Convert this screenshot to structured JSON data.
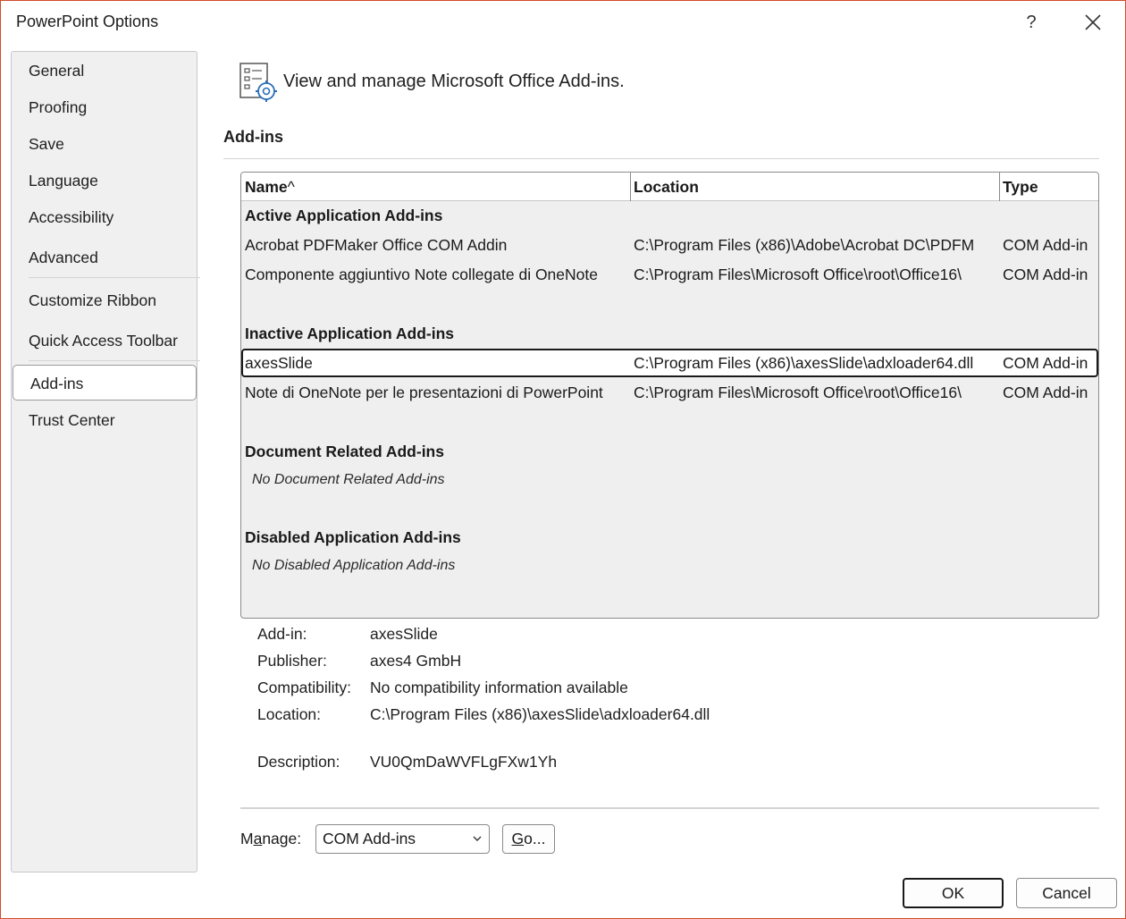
{
  "window": {
    "title": "PowerPoint Options",
    "help_label": "?",
    "close_icon": "close-icon",
    "border_color": "#d24b2a"
  },
  "sidebar": {
    "items": [
      {
        "label": "General"
      },
      {
        "label": "Proofing"
      },
      {
        "label": "Save"
      },
      {
        "label": "Language"
      },
      {
        "label": "Accessibility"
      },
      {
        "label": "Advanced"
      },
      {
        "label": "Customize Ribbon"
      },
      {
        "label": "Quick Access Toolbar"
      },
      {
        "label": "Add-ins",
        "selected": true
      },
      {
        "label": "Trust Center"
      }
    ]
  },
  "header": {
    "icon": "addins-settings-icon",
    "text": "View and manage Microsoft Office Add-ins."
  },
  "section": {
    "title": "Add-ins"
  },
  "table": {
    "columns": [
      {
        "label": "Name",
        "sort_indicator": "^"
      },
      {
        "label": "Location"
      },
      {
        "label": "Type"
      }
    ],
    "groups": [
      {
        "title": "Active Application Add-ins",
        "rows": [
          {
            "name": "Acrobat PDFMaker Office COM Addin",
            "location": "C:\\Program Files (x86)\\Adobe\\Acrobat DC\\PDFM",
            "type": "COM Add-in"
          },
          {
            "name": "Componente aggiuntivo Note collegate di OneNote",
            "location": "C:\\Program Files\\Microsoft Office\\root\\Office16\\",
            "type": "COM Add-in"
          }
        ]
      },
      {
        "title": "Inactive Application Add-ins",
        "rows": [
          {
            "name": "axesSlide",
            "location": "C:\\Program Files (x86)\\axesSlide\\adxloader64.dll",
            "type": "COM Add-in",
            "selected": true
          },
          {
            "name": "Note di OneNote per le presentazioni di PowerPoint",
            "location": "C:\\Program Files\\Microsoft Office\\root\\Office16\\",
            "type": "COM Add-in"
          }
        ]
      },
      {
        "title": "Document Related Add-ins",
        "empty_text": "No Document Related Add-ins"
      },
      {
        "title": "Disabled Application Add-ins",
        "empty_text": "No Disabled Application Add-ins"
      }
    ]
  },
  "details": {
    "addin_label": "Add-in:",
    "addin_value": "axesSlide",
    "publisher_label": "Publisher:",
    "publisher_value": "axes4 GmbH",
    "compatibility_label": "Compatibility:",
    "compatibility_value": "No compatibility information available",
    "location_label": "Location:",
    "location_value": "C:\\Program Files (x86)\\axesSlide\\adxloader64.dll",
    "description_label": "Description:",
    "description_value": "VU0QmDaWVFLgFXw1Yh"
  },
  "manage": {
    "label_pre": "M",
    "label_accel": "a",
    "label_post": "nage:",
    "selected_option": "COM Add-ins",
    "go_label_accel": "G",
    "go_label_post": "o..."
  },
  "footer": {
    "ok_label": "OK",
    "cancel_label": "Cancel"
  }
}
